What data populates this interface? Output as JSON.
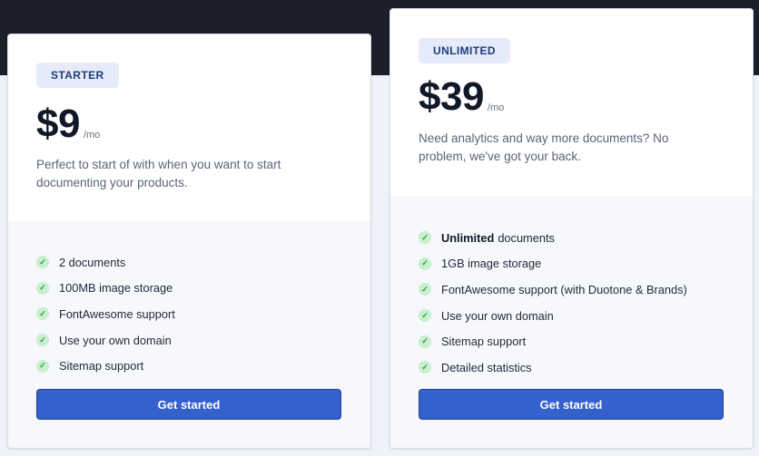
{
  "plans": [
    {
      "badge": "STARTER",
      "price": "$9",
      "period": "/mo",
      "description": "Perfect to start of with when you want to start documenting your products.",
      "features": [
        {
          "strong": "",
          "text": "2 documents"
        },
        {
          "strong": "",
          "text": "100MB image storage"
        },
        {
          "strong": "",
          "text": "FontAwesome support"
        },
        {
          "strong": "",
          "text": "Use your own domain"
        },
        {
          "strong": "",
          "text": "Sitemap support"
        }
      ],
      "cta": "Get started"
    },
    {
      "badge": "UNLIMITED",
      "price": "$39",
      "period": "/mo",
      "description": "Need analytics and way more documents? No problem, we've got your back.",
      "features": [
        {
          "strong": "Unlimited",
          "text": "documents"
        },
        {
          "strong": "",
          "text": "1GB image storage"
        },
        {
          "strong": "",
          "text": "FontAwesome support (with Duotone & Brands)"
        },
        {
          "strong": "",
          "text": "Use your own domain"
        },
        {
          "strong": "",
          "text": "Sitemap support"
        },
        {
          "strong": "",
          "text": "Detailed statistics"
        }
      ],
      "cta": "Get started"
    }
  ],
  "icons": {
    "feature": "check-circle-icon"
  },
  "colors": {
    "accent": "#3461cc",
    "header_band": "#1c1f2b",
    "check": "#2e9a47",
    "badge_bg": "#e5ebf8"
  }
}
